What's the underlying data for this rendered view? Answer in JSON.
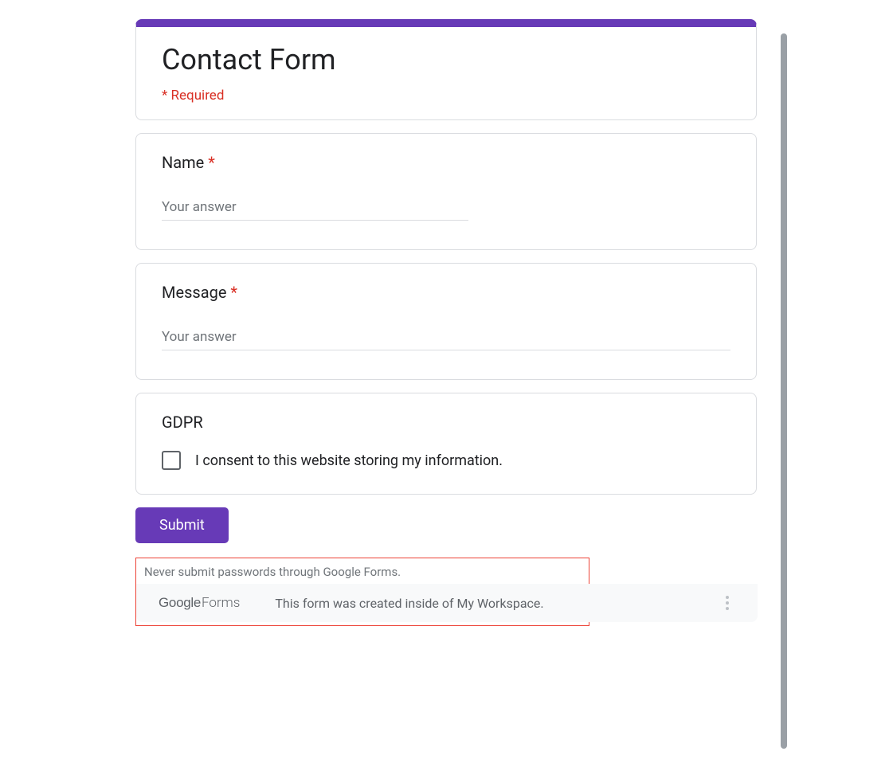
{
  "header": {
    "title": "Contact Form",
    "required_label": "* Required"
  },
  "questions": {
    "name": {
      "label": "Name",
      "required": "*",
      "placeholder": "Your answer"
    },
    "message": {
      "label": "Message",
      "required": "*",
      "placeholder": "Your answer"
    },
    "gdpr": {
      "label": "GDPR",
      "consent_text": "I consent to this website storing my information."
    }
  },
  "submit_label": "Submit",
  "footer": {
    "warning": "Never submit passwords through Google Forms.",
    "logo_google": "Google",
    "logo_forms": "Forms",
    "workspace_text": "This form was created inside of My Workspace."
  },
  "colors": {
    "accent": "#673ab7",
    "required": "#d93025"
  }
}
